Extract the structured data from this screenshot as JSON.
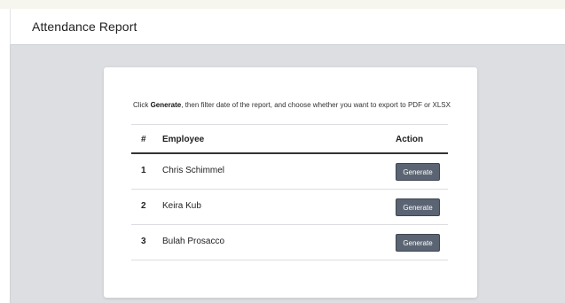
{
  "header": {
    "title": "Attendance Report"
  },
  "card": {
    "instructions": {
      "prefix": "Click ",
      "bold": "Generate",
      "suffix": ", then filter date of the report, and choose whether you want to export to PDF or XLSX"
    },
    "table": {
      "columns": {
        "num": "#",
        "employee": "Employee",
        "action": "Action"
      },
      "rows": [
        {
          "num": "1",
          "employee": "Chris Schimmel",
          "action": "Generate"
        },
        {
          "num": "2",
          "employee": "Keira Kub",
          "action": "Generate"
        },
        {
          "num": "3",
          "employee": "Bulah Prosacco",
          "action": "Generate"
        }
      ]
    }
  },
  "colors": {
    "button_bg": "#5b6472",
    "content_bg": "#dcdee2",
    "header_bg": "#ffffff"
  }
}
